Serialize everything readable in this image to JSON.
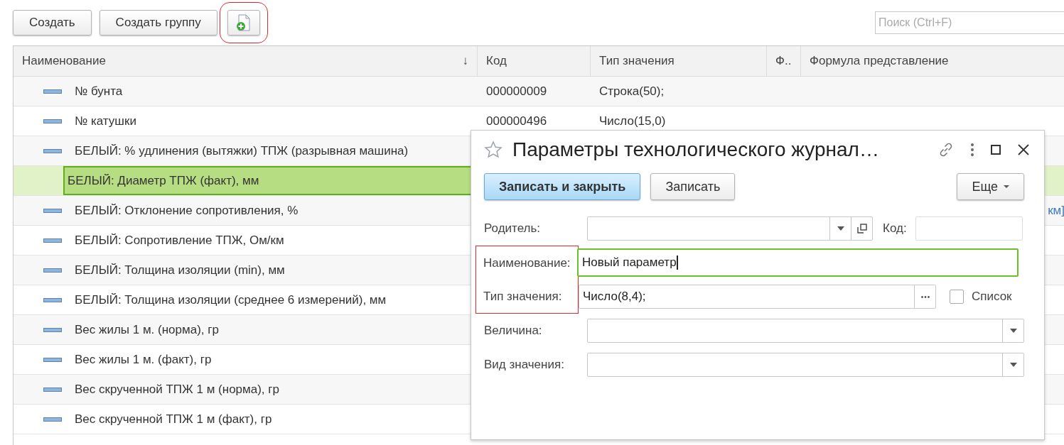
{
  "toolbar": {
    "buttons": [
      {
        "kind": "text",
        "label": "Создать",
        "highlighted": false
      },
      {
        "kind": "text",
        "label": "Создать группу",
        "highlighted": false
      },
      {
        "kind": "new-file",
        "highlighted": true
      }
    ],
    "search": {
      "placeholder": "Поиск (Ctrl+F)"
    }
  },
  "table": {
    "columns": [
      {
        "label": "Наименование",
        "sort_mark": "↓"
      },
      {
        "label": "Код"
      },
      {
        "label": "Тип значения"
      },
      {
        "label": "Ф.."
      },
      {
        "label": "Формула представление"
      }
    ],
    "rows": [
      {
        "name": "№ бунта",
        "code": "000000009",
        "type": "Строка(50);",
        "selected": false
      },
      {
        "name": "№ катушки",
        "code": "000000496",
        "type": "Число(15,0)",
        "selected": false
      },
      {
        "name": "БЕЛЫЙ: % удлинения (вытяжки) ТПЖ (разрывная машина)",
        "selected": false
      },
      {
        "name": "БЕЛЫЙ: Диаметр ТПЖ (факт), мм",
        "selected": true
      },
      {
        "name": "БЕЛЫЙ: Отклонение сопротивления, %",
        "formula": "км]",
        "selected": false
      },
      {
        "name": "БЕЛЫЙ: Сопротивление ТПЖ, Ом/км",
        "selected": false
      },
      {
        "name": "БЕЛЫЙ: Толщина изоляции (min), мм",
        "selected": false
      },
      {
        "name": "БЕЛЫЙ: Толщина изоляции (среднее 6 измерений), мм",
        "selected": false
      },
      {
        "name": "Вес жилы 1 м. (норма), гр",
        "selected": false
      },
      {
        "name": "Вес жилы 1 м. (факт), гр",
        "selected": false
      },
      {
        "name": "Вес скрученной ТПЖ 1 м (норма), гр",
        "selected": false
      },
      {
        "name": "Вес скрученной ТПЖ 1 м (факт), гр",
        "selected": false
      }
    ]
  },
  "dialog": {
    "title": "Параметры технологического журнал…",
    "favorite": false,
    "buttons": [
      {
        "kind": "default",
        "label": "Записать и закрыть"
      },
      {
        "kind": "plain",
        "label": "Записать"
      },
      {
        "kind": "menu",
        "label": "Еще"
      }
    ],
    "parent": {
      "label": "Родитель:"
    },
    "code": {
      "label": "Код:"
    },
    "name": {
      "label": "Наименование:",
      "value": "Новый параметр",
      "focused": true,
      "highlighted": true
    },
    "value_type": {
      "label": "Тип значения:",
      "value": "Число(8,4);",
      "highlighted": true
    },
    "list": {
      "label": "Список",
      "checked": false
    },
    "quantity": {
      "label": "Величина:"
    },
    "value_kind": {
      "label": "Вид значения:"
    }
  }
}
